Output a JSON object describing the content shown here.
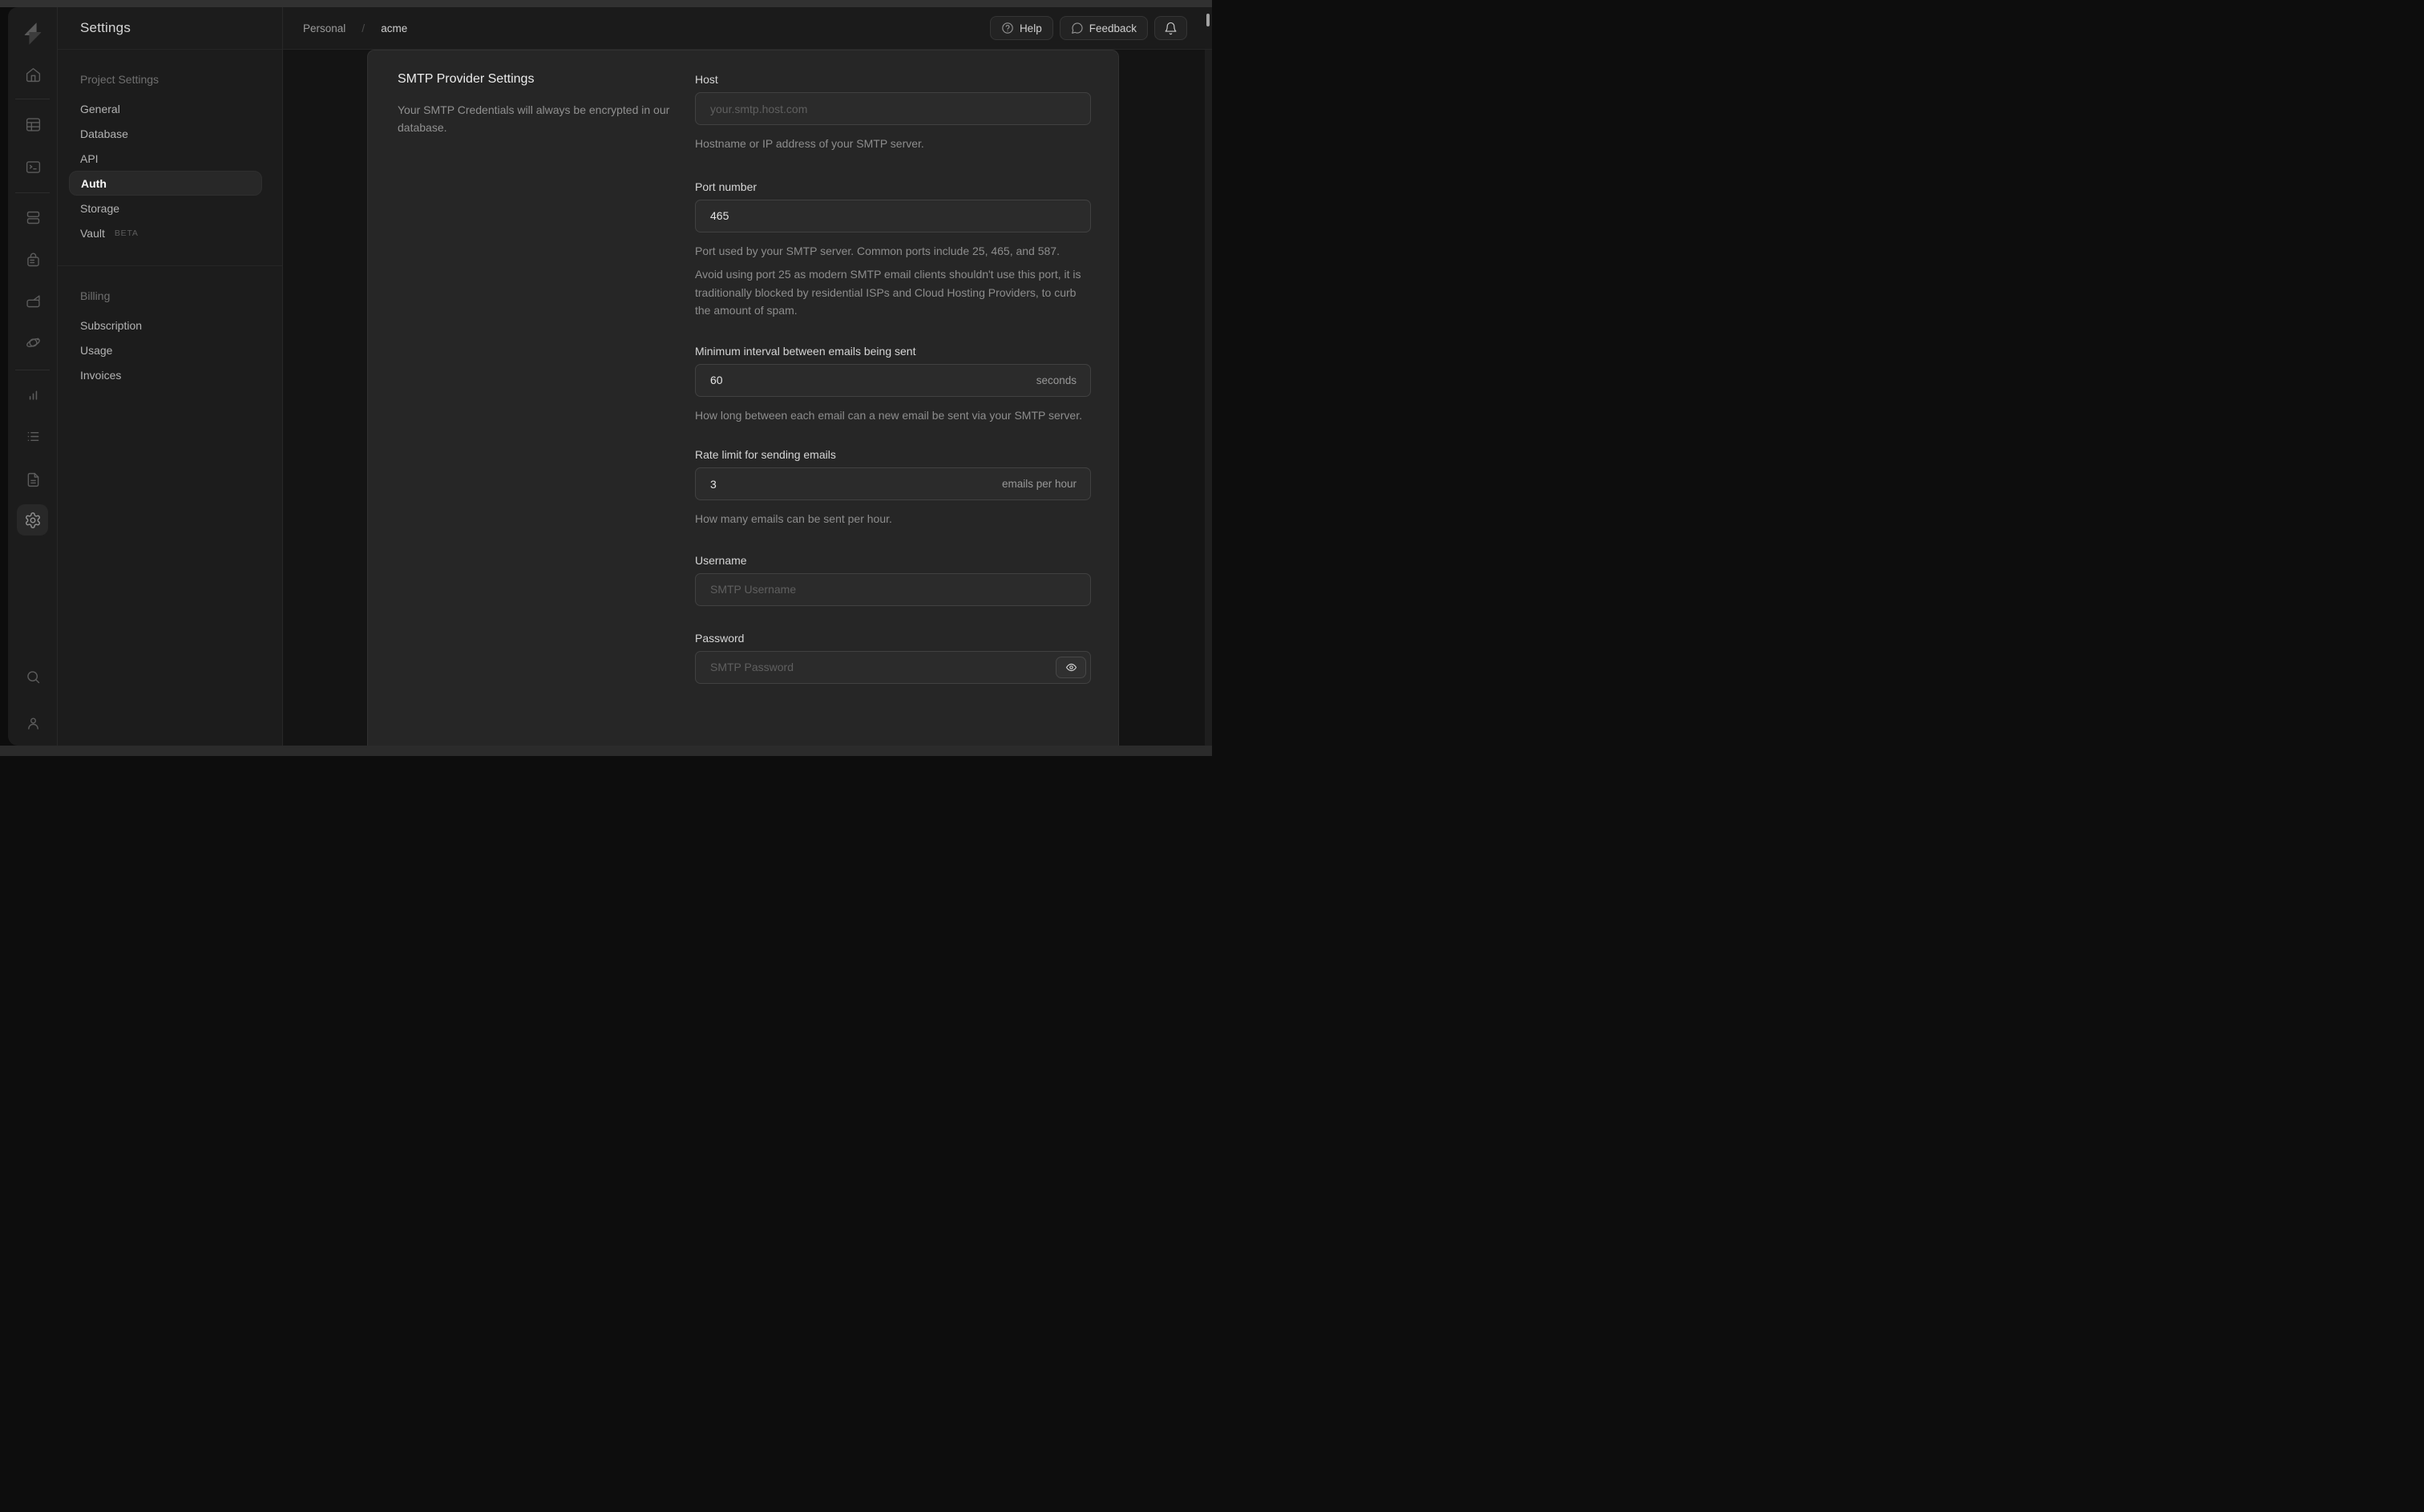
{
  "titlebar": {
    "title": "Settings",
    "breadcrumb": {
      "organization": "Personal",
      "separator": "/",
      "project": "acme"
    },
    "help_label": "Help",
    "feedback_label": "Feedback"
  },
  "rail": {
    "icons": [
      "supabase-logo",
      "home",
      "table-editor",
      "sql-editor",
      "database",
      "authentication",
      "storage",
      "realtime",
      "reports",
      "logs",
      "docs",
      "settings",
      "search",
      "account"
    ],
    "active_icon": "settings"
  },
  "sidebar": {
    "sections": [
      {
        "heading": "Project Settings",
        "items": [
          {
            "label": "General"
          },
          {
            "label": "Database"
          },
          {
            "label": "API"
          },
          {
            "label": "Auth",
            "active": true
          },
          {
            "label": "Storage"
          },
          {
            "label": "Vault",
            "badge": "BETA"
          }
        ]
      },
      {
        "heading": "Billing",
        "items": [
          {
            "label": "Subscription"
          },
          {
            "label": "Usage"
          },
          {
            "label": "Invoices"
          }
        ]
      }
    ]
  },
  "panel": {
    "heading": "SMTP Provider Settings",
    "description": "Your SMTP Credentials will always be encrypted in our database.",
    "fields": {
      "host": {
        "label": "Host",
        "placeholder": "your.smtp.host.com",
        "help": "Hostname or IP address of your SMTP server."
      },
      "port": {
        "label": "Port number",
        "value": "465",
        "help": "Port used by your SMTP server. Common ports include 25, 465, and 587.",
        "note": "Avoid using port 25 as modern SMTP email clients shouldn't use this port, it is traditionally blocked by residential ISPs and Cloud Hosting Providers, to curb the amount of spam."
      },
      "interval": {
        "label": "Minimum interval between emails being sent",
        "value": "60",
        "suffix": "seconds",
        "help": "How long between each email can a new email be sent via your SMTP server."
      },
      "rate": {
        "label": "Rate limit for sending emails",
        "value": "3",
        "suffix": "emails per hour",
        "help": "How many emails can be sent per hour."
      },
      "username": {
        "label": "Username",
        "placeholder": "SMTP Username"
      },
      "password": {
        "label": "Password",
        "placeholder": "SMTP Password"
      }
    }
  },
  "colors": {
    "window_bg": "#1c1c1c",
    "backdrop_bg": "#141414",
    "panel_bg": "#262626",
    "input_bg": "#2b2b2b",
    "input_border": "#414141",
    "heading_text": "#ececec",
    "muted_text": "#8d8d8d"
  }
}
